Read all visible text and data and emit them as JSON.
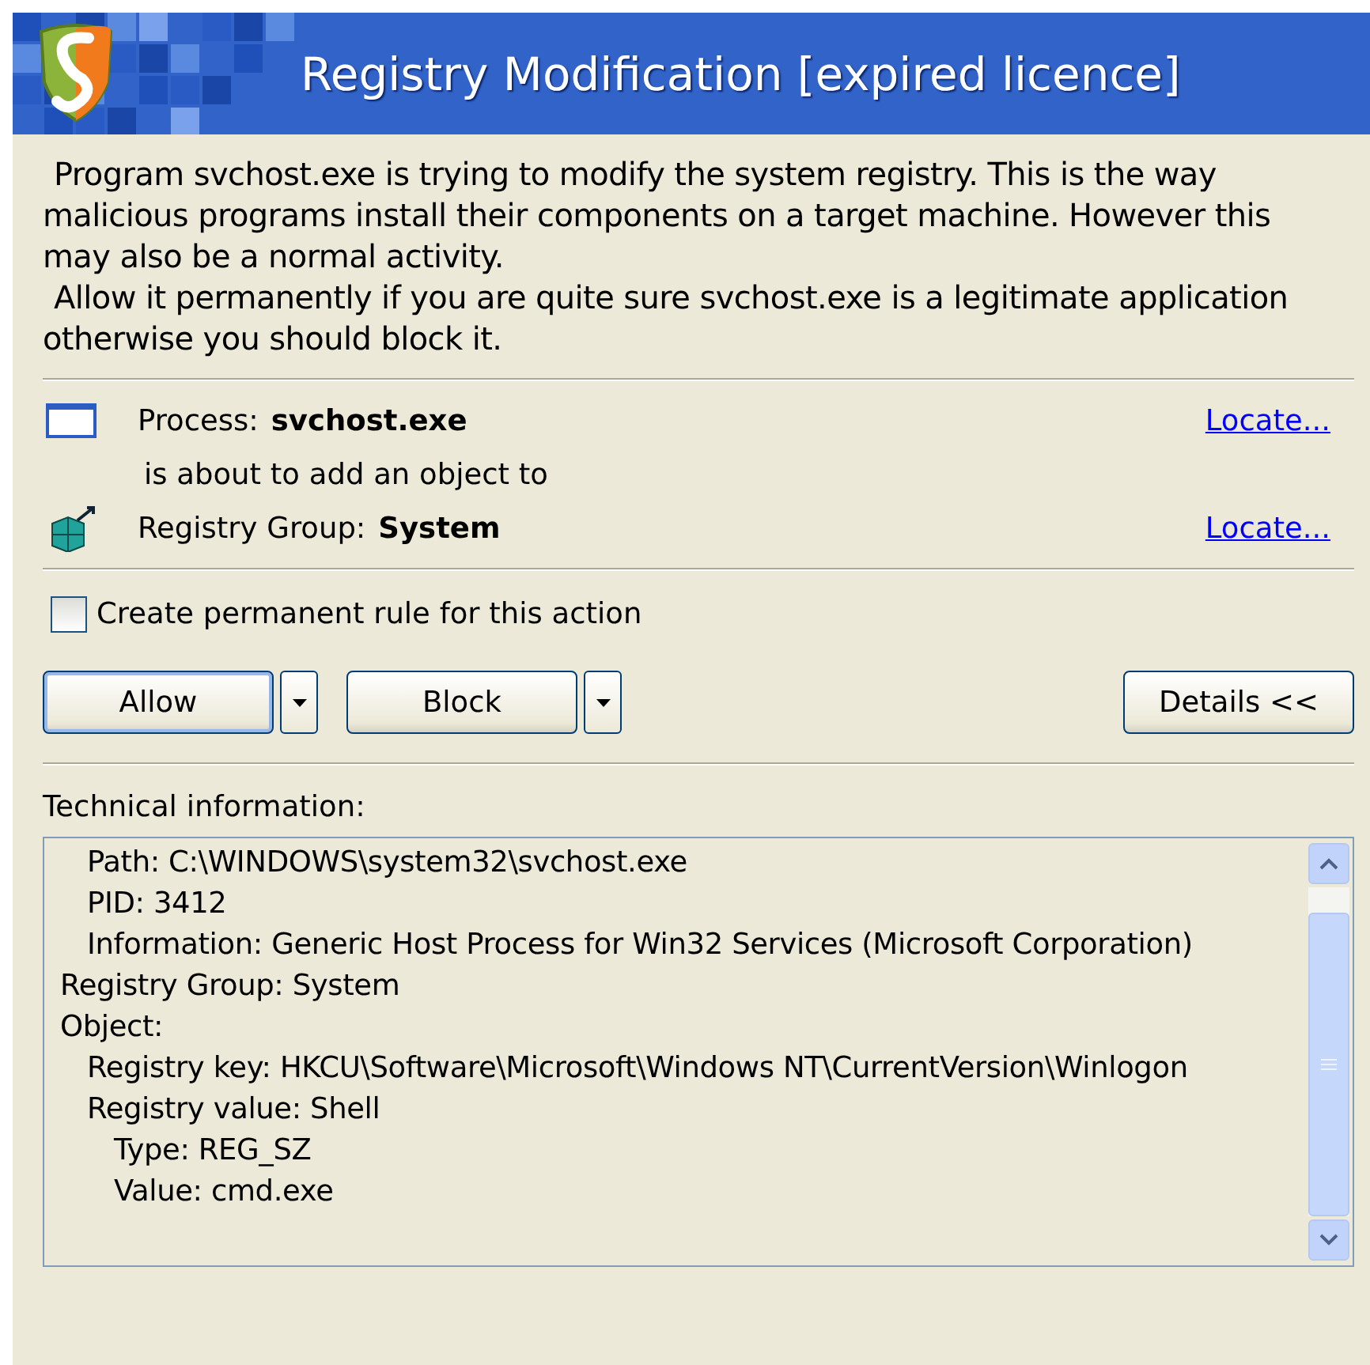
{
  "window": {
    "title": "Registry Modification [expired licence]"
  },
  "description": [
    "Program svchost.exe is trying to modify the system registry. This is the way malicious programs install their components on a target machine. However this may also be a normal activity.",
    "Allow it permanently if you are quite sure svchost.exe is a legitimate application otherwise you should block it."
  ],
  "process": {
    "label": "Process:",
    "value": "svchost.exe",
    "link": "Locate..."
  },
  "action_text": "is about to add an object to",
  "registry_group": {
    "label": "Registry Group:",
    "value": "System",
    "link": "Locate..."
  },
  "permanent_rule": {
    "label": "Create permanent rule for this action",
    "checked": false
  },
  "buttons": [
    {
      "label": "Allow",
      "dropdown": true,
      "focused": true
    },
    {
      "label": "Block",
      "dropdown": true,
      "focused": false
    }
  ],
  "details_button": "Details <<",
  "technical_info": {
    "label": "Technical information:",
    "lines": [
      {
        "children": [
          {
            "text": "Path: C:\\WINDOWS\\system32\\svchost.exe"
          },
          {
            "text": "PID: 3412"
          },
          {
            "text": "Information: Generic Host Process for Win32 Services (Microsoft Corporation)"
          }
        ]
      },
      {
        "text": "Registry Group: System"
      },
      {
        "text": "Object:",
        "children": [
          {
            "text": "Registry key: HKCU\\Software\\Microsoft\\Windows NT\\CurrentVersion\\Winlogon"
          },
          {
            "text": "Registry value: Shell",
            "children": [
              {
                "text": "Type: REG_SZ"
              },
              {
                "text": "Value: cmd.exe"
              }
            ]
          }
        ]
      }
    ]
  }
}
